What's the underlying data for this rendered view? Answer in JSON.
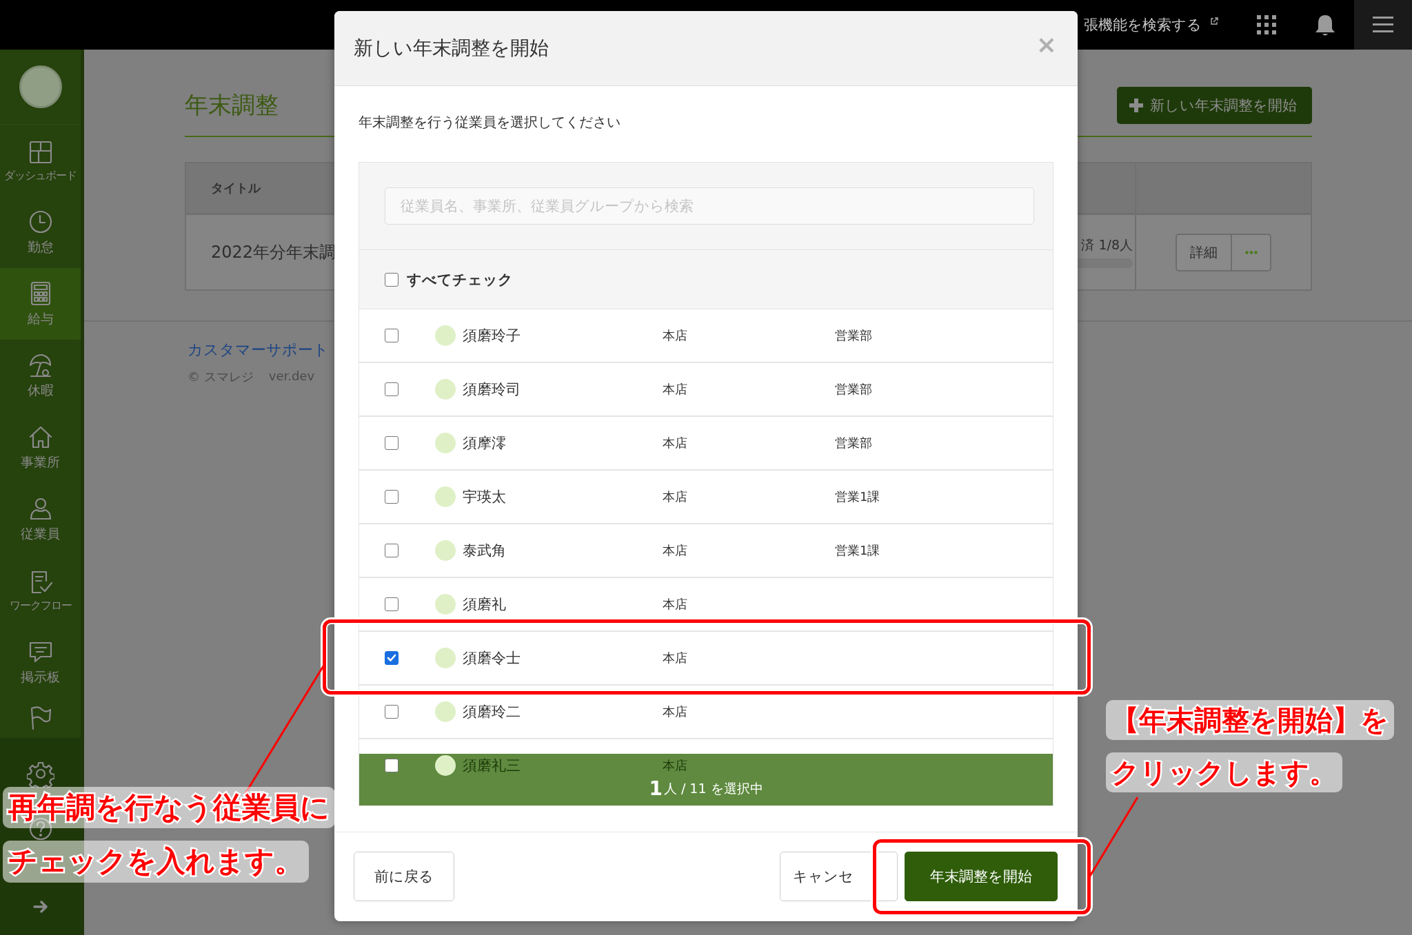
{
  "topbar": {
    "search_link": "張機能を検索する"
  },
  "sidebar": {
    "items": [
      {
        "kind": "dashboard",
        "label": "ダッシュボード",
        "selected": false
      },
      {
        "kind": "attendance",
        "label": "勤怠",
        "selected": false
      },
      {
        "kind": "payroll",
        "label": "給与",
        "selected": true
      },
      {
        "kind": "leave",
        "label": "休暇",
        "selected": false
      },
      {
        "kind": "office",
        "label": "事業所",
        "selected": false
      },
      {
        "kind": "employee",
        "label": "従業員",
        "selected": false
      },
      {
        "kind": "workflow",
        "label": "ワークフロー",
        "selected": false
      },
      {
        "kind": "board",
        "label": "掲示板",
        "selected": false
      },
      {
        "kind": "flag",
        "selected": false
      },
      {
        "kind": "settings",
        "selected": false
      },
      {
        "kind": "help",
        "selected": false
      }
    ]
  },
  "page": {
    "title": "年末調整",
    "new_button": "新しい年末調整を開始",
    "table": {
      "columns": [
        "タイトル"
      ],
      "rows": [
        {
          "title": "2022年分年末調",
          "status": "済 1/8人",
          "detail_button": "詳細"
        }
      ]
    },
    "support_link": "カスタマーサポート",
    "copyright": "© スマレジ",
    "version": "ver.dev"
  },
  "modal": {
    "title": "新しい年末調整を開始",
    "close": "×",
    "instruction": "年末調整を行う従業員を選択してください",
    "search": {
      "placeholder": "従業員名、事業所、従業員グループから検索"
    },
    "check_all": {
      "label": "すべてチェック",
      "checked": false
    },
    "employees": [
      {
        "name": "須磨玲子",
        "office": "本店",
        "department": "営業部",
        "checked": false
      },
      {
        "name": "須磨玲司",
        "office": "本店",
        "department": "営業部",
        "checked": false
      },
      {
        "name": "須摩澪",
        "office": "本店",
        "department": "営業部",
        "checked": false
      },
      {
        "name": "宇瑛太",
        "office": "本店",
        "department": "営業1課",
        "checked": false
      },
      {
        "name": "泰武角",
        "office": "本店",
        "department": "営業1課",
        "checked": false
      },
      {
        "name": "須磨礼",
        "office": "本店",
        "checked": false
      },
      {
        "name": "須磨令士",
        "office": "本店",
        "checked": true
      },
      {
        "name": "須磨玲二",
        "office": "本店",
        "checked": false
      },
      {
        "name": "須磨礼三",
        "office": "本店",
        "checked": false
      }
    ],
    "status": {
      "count": "1",
      "text": "人 / 11 を選択中"
    },
    "buttons": {
      "back": "前に戻る",
      "cancel": "キャンセ",
      "start": "年末調整を開始"
    }
  },
  "annotations": [
    {
      "lines": [
        "再年調を行なう従業員に",
        "チェックを入れます。"
      ]
    },
    {
      "lines": [
        "【年末調整を開始】を",
        "クリックします。"
      ]
    }
  ]
}
